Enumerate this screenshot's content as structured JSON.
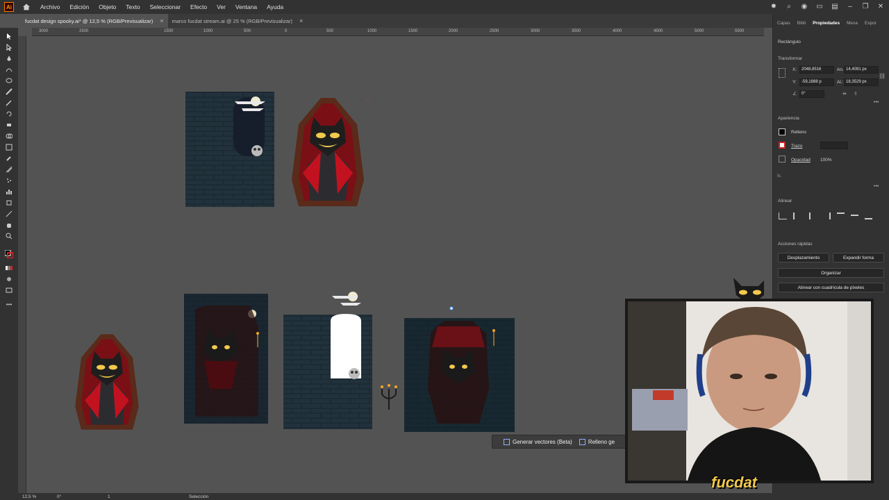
{
  "app": {
    "logo": "Ai",
    "menu": [
      "Archivo",
      "Edición",
      "Objeto",
      "Texto",
      "Seleccionar",
      "Efecto",
      "Ver",
      "Ventana",
      "Ayuda"
    ]
  },
  "tabs": [
    {
      "label": "fucdat design spooky.ai* @ 12,5 % (RGB/Previsualizar)",
      "active": true
    },
    {
      "label": "marco fucdat stream.ai @ 25 % (RGB/Previsualizar)",
      "active": false
    }
  ],
  "ruler": {
    "top_labels": [
      "3000",
      "2500",
      "1500",
      "1000",
      "500",
      "0",
      "500",
      "1000",
      "1500",
      "2000",
      "2500",
      "3000",
      "3500",
      "4000",
      "4500",
      "5000",
      "5500"
    ]
  },
  "panel": {
    "tabs": [
      "Capas",
      "Bibli",
      "Propiedades",
      "Mesa",
      "Expor"
    ],
    "active_tab": "Propiedades",
    "object_type": "Rectángulo",
    "transform": {
      "title": "Transformar",
      "x_label": "X:",
      "x_value": "2048,8516",
      "y_label": "Y:",
      "y_value": "-59,1888 p",
      "w_label": "An.:",
      "w_value": "14,4091 px",
      "h_label": "Al.:",
      "h_value": "18,3529 px",
      "angle_value": "0°"
    },
    "appearance": {
      "title": "Apariencia",
      "fill_label": "Relleno",
      "stroke_label": "Trazo",
      "opacity_label": "Opacidad",
      "opacity_value": "100%",
      "fx_label": "fx."
    },
    "align": {
      "title": "Alinear"
    },
    "quick_actions": {
      "title": "Acciones rápidas",
      "offset_path": "Desplazamiento",
      "expand_shape": "Expandir forma",
      "arrange": "Organizar",
      "pixel_grid": "Alinear con cuadrícula de píxeles"
    }
  },
  "context_bar": {
    "generate_vectors": "Generar vectores (Beta)",
    "generative_fill": "Relleno ge"
  },
  "status": {
    "zoom": "12,5 %",
    "rotation": "0°",
    "artboard": "1",
    "tool": "Selección"
  },
  "overlay": {
    "brand_logo": "fucdat"
  },
  "colors": {
    "canvas": "#535353",
    "ui_dark": "#323232",
    "brick": "#1e2b33",
    "cape_red": "#b3101f",
    "coffin": "#5b2b1b",
    "cat_eye": "#f2c94c"
  }
}
